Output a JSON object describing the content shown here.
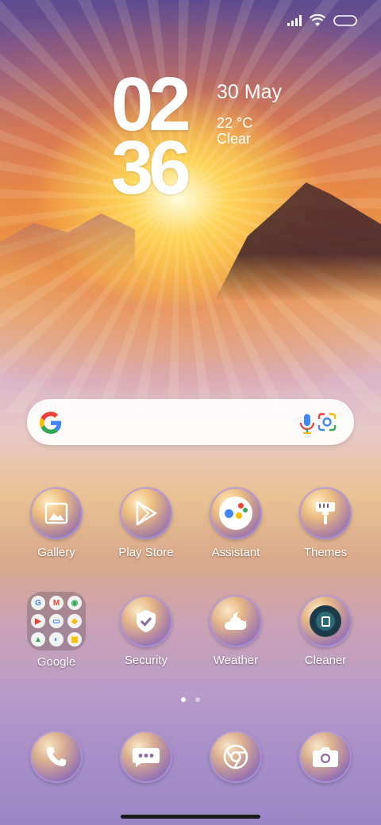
{
  "clock": {
    "hour": "02",
    "minute": "36"
  },
  "weather": {
    "date": "30 May",
    "temperature": "22 °C",
    "condition": "Clear"
  },
  "status_bar": {
    "signal_icon": "signal-icon",
    "wifi_icon": "wifi-icon",
    "battery_icon": "battery-icon"
  },
  "search": {
    "logo_icon": "google-g-icon",
    "mic_icon": "mic-icon",
    "lens_icon": "google-lens-icon"
  },
  "apps": {
    "row1": [
      {
        "label": "Gallery",
        "icon": "gallery-icon"
      },
      {
        "label": "Play Store",
        "icon": "play-store-icon"
      },
      {
        "label": "Assistant",
        "icon": "assistant-icon"
      },
      {
        "label": "Themes",
        "icon": "brush-icon"
      }
    ],
    "row2": [
      {
        "label": "Google",
        "icon": "folder-icon"
      },
      {
        "label": "Security",
        "icon": "shield-icon"
      },
      {
        "label": "Weather",
        "icon": "weather-icon"
      },
      {
        "label": "Cleaner",
        "icon": "cleaner-icon"
      }
    ]
  },
  "folder_apps": [
    "G",
    "M",
    "◉",
    "▶",
    "▭",
    "◆",
    "▲",
    "◐",
    "▦"
  ],
  "dock": [
    {
      "icon": "phone-icon"
    },
    {
      "icon": "messages-icon"
    },
    {
      "icon": "chrome-icon"
    },
    {
      "icon": "camera-icon"
    }
  ],
  "pagination": {
    "pages": 2,
    "active_page": 1
  },
  "colors": {
    "accent_blue": "#4285F4",
    "accent_red": "#EA4335",
    "accent_yellow": "#FBBC05",
    "accent_green": "#34A853"
  }
}
